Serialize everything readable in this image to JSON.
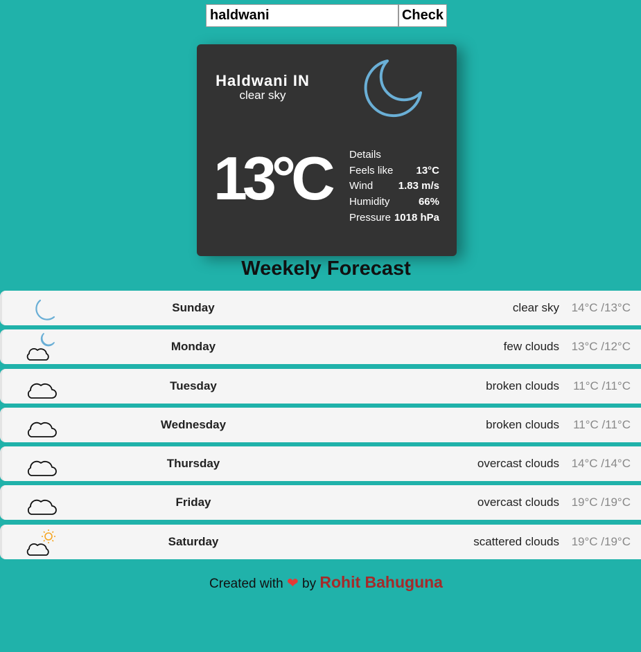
{
  "search": {
    "value": "haldwani",
    "button_label": "Check"
  },
  "current": {
    "city": "Haldwani IN",
    "description": "clear sky",
    "icon": "moon-icon",
    "temperature": "13°C",
    "details": {
      "heading": "Details",
      "rows": [
        {
          "label": "Feels like",
          "value": "13°C"
        },
        {
          "label": "Wind",
          "value": "1.83 m/s"
        },
        {
          "label": "Humidity",
          "value": "66%"
        },
        {
          "label": "Pressure",
          "value": "1018 hPa"
        }
      ]
    }
  },
  "forecast": {
    "title": "Weekely Forecast",
    "days": [
      {
        "day": "Sunday",
        "description": "clear sky",
        "range": "14°C /13°C",
        "icon": "moon-icon"
      },
      {
        "day": "Monday",
        "description": "few clouds",
        "range": "13°C /12°C",
        "icon": "cloud-moon-icon"
      },
      {
        "day": "Tuesday",
        "description": "broken clouds",
        "range": "11°C /11°C",
        "icon": "cloud-icon"
      },
      {
        "day": "Wednesday",
        "description": "broken clouds",
        "range": "11°C /11°C",
        "icon": "cloud-icon"
      },
      {
        "day": "Thursday",
        "description": "overcast clouds",
        "range": "14°C /14°C",
        "icon": "cloud-icon"
      },
      {
        "day": "Friday",
        "description": "overcast clouds",
        "range": "19°C /19°C",
        "icon": "cloud-icon"
      },
      {
        "day": "Saturday",
        "description": "scattered clouds",
        "range": "19°C /19°C",
        "icon": "cloud-sun-icon"
      }
    ]
  },
  "footer": {
    "prefix": "Created with",
    "heart": "❤",
    "by": "by",
    "author": "Rohit Bahuguna"
  },
  "colors": {
    "background": "#20b2aa",
    "card": "#333333",
    "moon": "#6aafd6",
    "sun": "#f5a623",
    "heart": "#e53935",
    "author": "#a52a2a"
  }
}
